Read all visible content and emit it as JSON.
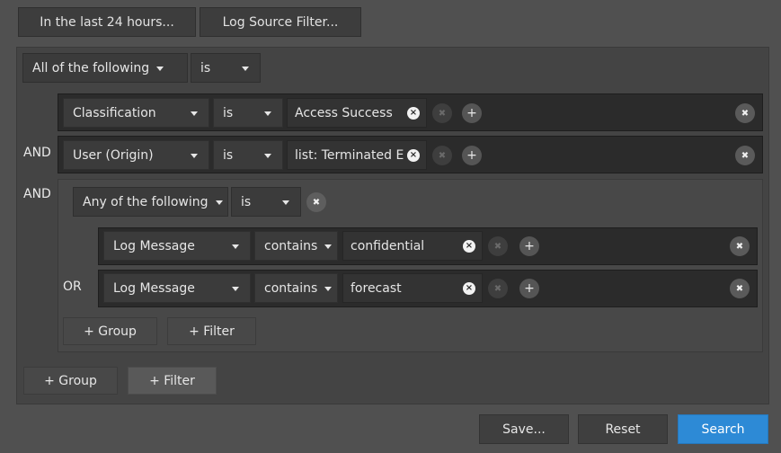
{
  "top_bar": {
    "time_filter": "In the last 24 hours...",
    "log_source_filter": "Log Source Filter..."
  },
  "root": {
    "quantifier": "All of the following",
    "operator": "is"
  },
  "filters": [
    {
      "connector": "",
      "field": "Classification",
      "operator": "is",
      "value": "Access Success"
    },
    {
      "connector": "AND",
      "field": "User (Origin)",
      "operator": "is",
      "value": "list: Terminated E"
    }
  ],
  "group": {
    "connector": "AND",
    "quantifier": "Any of the following",
    "operator": "is",
    "filters": [
      {
        "connector": "",
        "field": "Log Message",
        "operator": "contains",
        "value": "confidential"
      },
      {
        "connector": "OR",
        "field": "Log Message",
        "operator": "contains",
        "value": "forecast"
      }
    ],
    "add_group_label": "+ Group",
    "add_filter_label": "+ Filter"
  },
  "root_actions": {
    "add_group_label": "+ Group",
    "add_filter_label": "+ Filter"
  },
  "footer": {
    "save_label": "Save...",
    "reset_label": "Reset",
    "search_label": "Search"
  },
  "glyphs": {
    "clear": "×",
    "remove": "✖",
    "add": "+"
  },
  "colors": {
    "background": "#505050",
    "panel": "#444444",
    "row": "#2b2b2b",
    "primary": "#2d8ad6"
  }
}
